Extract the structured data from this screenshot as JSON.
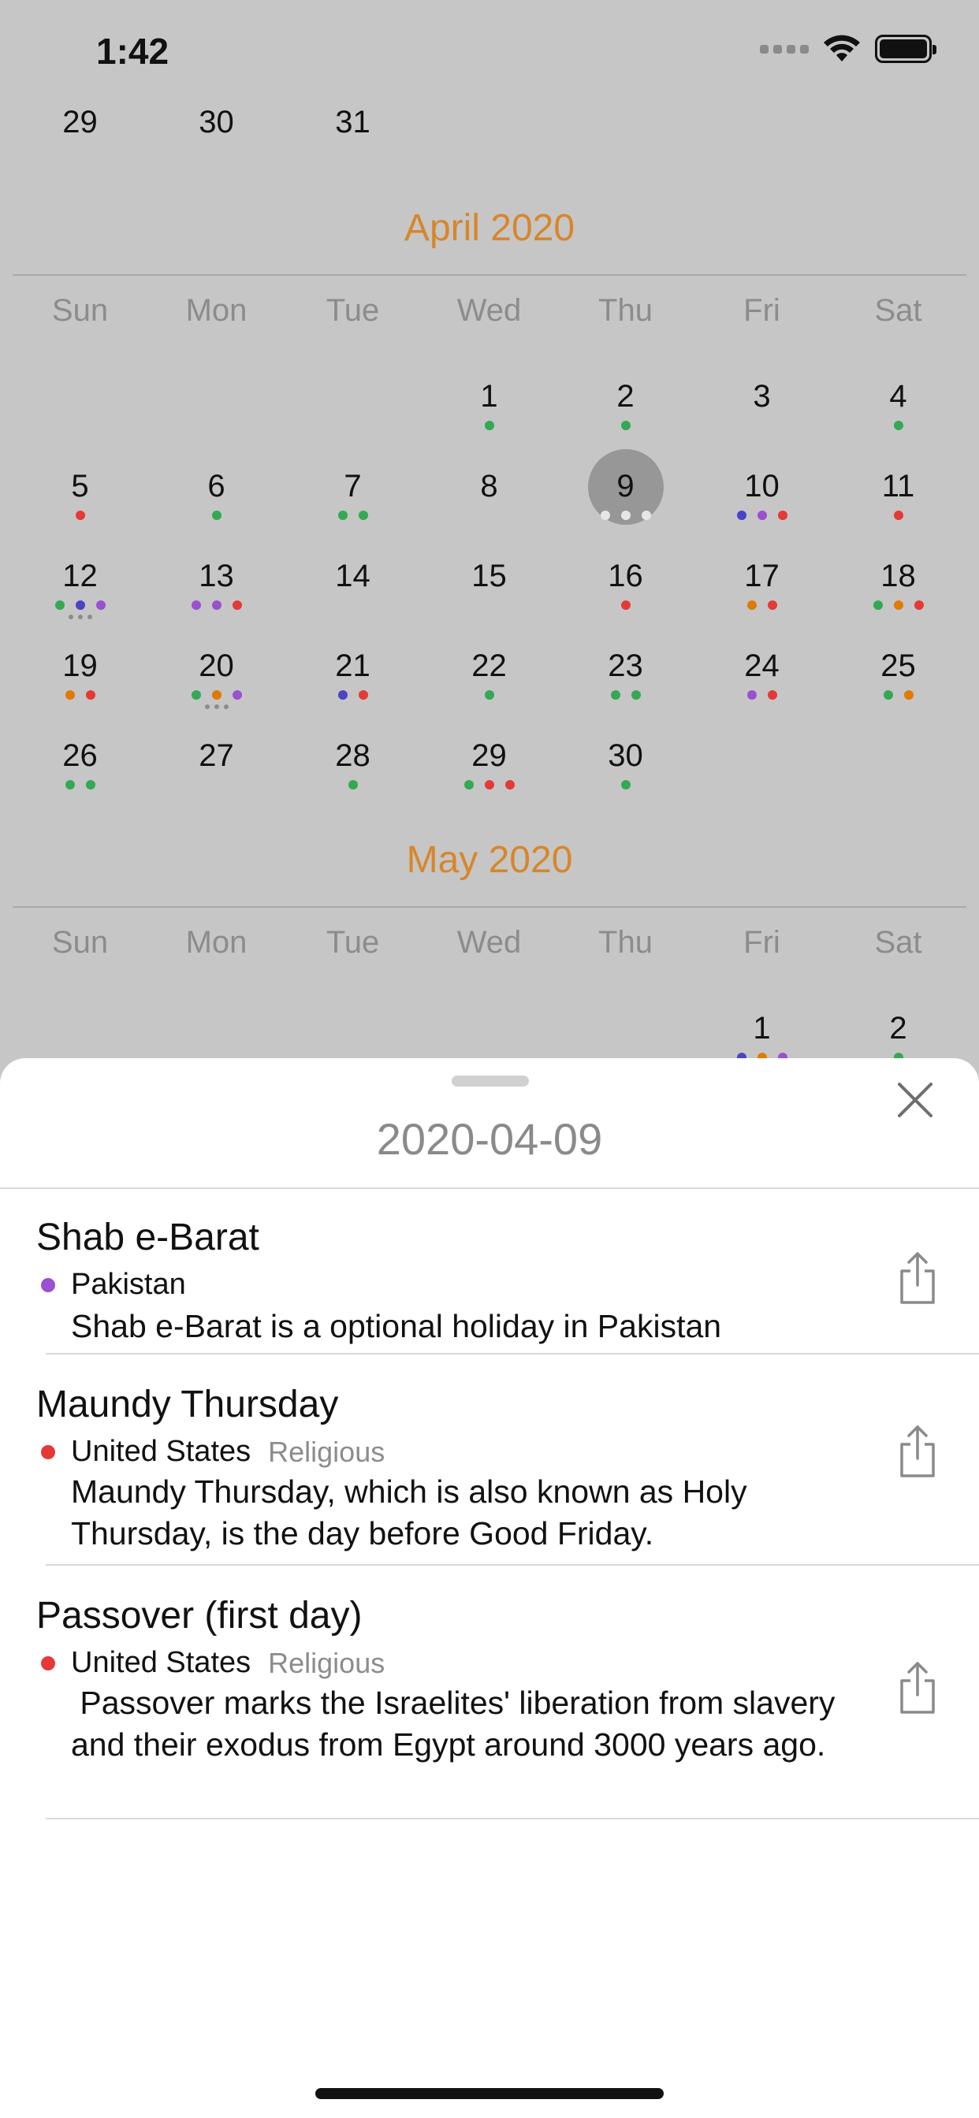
{
  "status": {
    "time": "1:42"
  },
  "colors": {
    "green": "#34a853",
    "red": "#e53935",
    "purple": "#9b4fd1",
    "blue": "#4a44c6",
    "orange": "#e07b00",
    "accent": "#d8862b"
  },
  "calendar": {
    "prev_tail": [
      "29",
      "30",
      "31"
    ],
    "weekdays": [
      "Sun",
      "Mon",
      "Tue",
      "Wed",
      "Thu",
      "Fri",
      "Sat"
    ],
    "april": {
      "title": "April 2020",
      "selected": "9",
      "days": [
        {
          "d": "1",
          "dots": [
            "green"
          ]
        },
        {
          "d": "2",
          "dots": [
            "green"
          ]
        },
        {
          "d": "3",
          "dots": []
        },
        {
          "d": "4",
          "dots": [
            "green"
          ]
        },
        {
          "d": "5",
          "dots": [
            "red"
          ]
        },
        {
          "d": "6",
          "dots": [
            "green"
          ]
        },
        {
          "d": "7",
          "dots": [
            "green",
            "green"
          ]
        },
        {
          "d": "8",
          "dots": []
        },
        {
          "d": "9",
          "dots": [
            "white",
            "white",
            "white"
          ]
        },
        {
          "d": "10",
          "dots": [
            "blue",
            "purple",
            "red"
          ]
        },
        {
          "d": "11",
          "dots": [
            "red"
          ]
        },
        {
          "d": "12",
          "dots": [
            "green",
            "blue",
            "purple"
          ],
          "more": true
        },
        {
          "d": "13",
          "dots": [
            "purple",
            "purple",
            "red"
          ]
        },
        {
          "d": "14",
          "dots": []
        },
        {
          "d": "15",
          "dots": []
        },
        {
          "d": "16",
          "dots": [
            "red"
          ]
        },
        {
          "d": "17",
          "dots": [
            "orange",
            "red"
          ]
        },
        {
          "d": "18",
          "dots": [
            "green",
            "orange",
            "red"
          ]
        },
        {
          "d": "19",
          "dots": [
            "orange",
            "red"
          ]
        },
        {
          "d": "20",
          "dots": [
            "green",
            "orange",
            "purple"
          ],
          "more": true
        },
        {
          "d": "21",
          "dots": [
            "blue",
            "red"
          ]
        },
        {
          "d": "22",
          "dots": [
            "green"
          ]
        },
        {
          "d": "23",
          "dots": [
            "green",
            "green"
          ]
        },
        {
          "d": "24",
          "dots": [
            "purple",
            "red"
          ]
        },
        {
          "d": "25",
          "dots": [
            "green",
            "orange"
          ]
        },
        {
          "d": "26",
          "dots": [
            "green",
            "green"
          ]
        },
        {
          "d": "27",
          "dots": []
        },
        {
          "d": "28",
          "dots": [
            "green"
          ]
        },
        {
          "d": "29",
          "dots": [
            "green",
            "red",
            "red"
          ]
        },
        {
          "d": "30",
          "dots": [
            "green"
          ]
        }
      ]
    },
    "may": {
      "title": "May 2020",
      "days": [
        {
          "d": "1",
          "dots": [
            "blue",
            "orange",
            "purple"
          ]
        },
        {
          "d": "2",
          "dots": [
            "green"
          ]
        }
      ]
    }
  },
  "sheet": {
    "date": "2020-04-09",
    "events": [
      {
        "title": "Shab e-Barat",
        "color": "purple",
        "country": "Pakistan",
        "category": "",
        "description": "Shab e-Barat is a optional holiday in Pakistan"
      },
      {
        "title": "Maundy Thursday",
        "color": "red",
        "country": "United States",
        "category": "Religious",
        "description": "Maundy Thursday, which is also known as Holy Thursday, is the day before Good Friday."
      },
      {
        "title": "Passover (first day)",
        "color": "red",
        "country": "United States",
        "category": "Religious",
        "description": " Passover marks the Israelites' liberation from slavery and their exodus from Egypt around 3000 years ago."
      }
    ]
  }
}
